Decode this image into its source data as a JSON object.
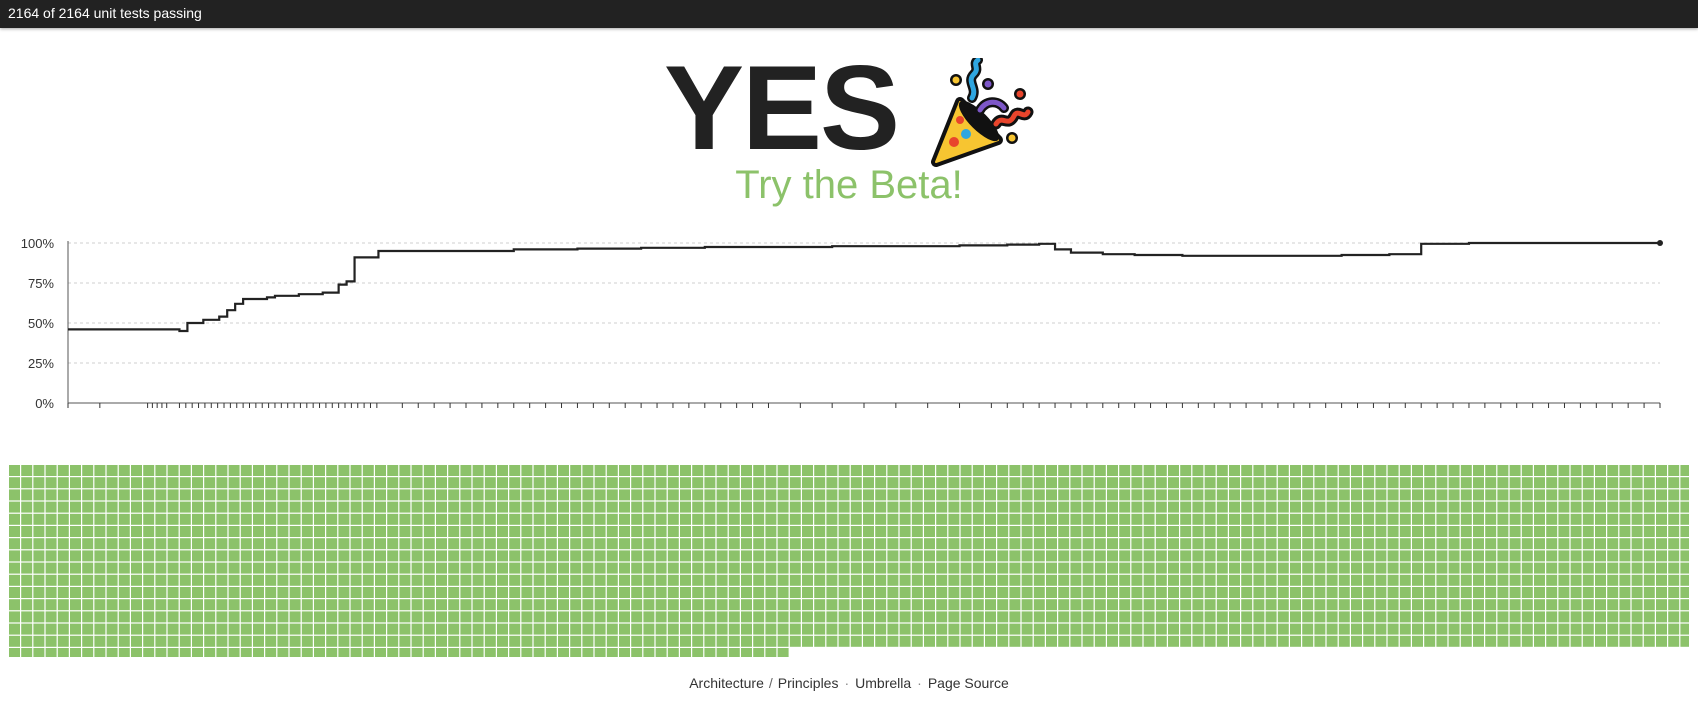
{
  "header": {
    "status_text": "2164 of 2164 unit tests passing"
  },
  "hero": {
    "headline": "YES",
    "icon": "party-popper-icon",
    "beta_link": "Try the Beta!"
  },
  "colors": {
    "accent_green": "#8cc26a",
    "bar_dark": "#222222",
    "line": "#222222"
  },
  "chart_data": {
    "type": "line",
    "ylim": [
      0,
      100
    ],
    "yticks": [
      "0%",
      "25%",
      "50%",
      "75%",
      "100%"
    ],
    "grid": true,
    "x": [
      0,
      3,
      5,
      7,
      7.5,
      8.5,
      9.5,
      10,
      10.5,
      11,
      12.5,
      13,
      14.5,
      16,
      17,
      17.5,
      18,
      19.5,
      24,
      28,
      32,
      36,
      40,
      44,
      48,
      52,
      56,
      59,
      61,
      62,
      63,
      65,
      67,
      70,
      75,
      80,
      83,
      84.5,
      85,
      88,
      92,
      96,
      100
    ],
    "values": [
      46,
      46,
      46,
      45,
      50,
      52,
      54,
      58,
      62,
      65,
      66,
      67,
      68,
      69,
      74,
      76,
      91,
      95,
      95,
      96,
      96.5,
      97,
      97.5,
      97.5,
      98,
      98,
      98.5,
      99,
      99.5,
      96,
      94,
      93,
      92.5,
      92,
      92,
      92.5,
      93,
      93,
      99.5,
      100,
      100,
      100,
      100
    ],
    "ticks_x": [
      0,
      2,
      5,
      5.3,
      5.6,
      5.9,
      6.2,
      7,
      7.4,
      7.8,
      8.2,
      8.6,
      9,
      9.4,
      9.8,
      10.2,
      10.6,
      11,
      11.4,
      11.8,
      12.2,
      12.6,
      13,
      13.4,
      13.8,
      14.2,
      14.6,
      15,
      15.4,
      15.8,
      16.2,
      16.6,
      17,
      17.4,
      17.8,
      18.2,
      18.6,
      19,
      19.4,
      21,
      22,
      23,
      24,
      25,
      26,
      27,
      28,
      29,
      30,
      31,
      32,
      33,
      34,
      35,
      36,
      37,
      38,
      39,
      40,
      41,
      42,
      43,
      44,
      46,
      48,
      50,
      52,
      54,
      56,
      58,
      59,
      60,
      61,
      62,
      63,
      64,
      65,
      66,
      67,
      68,
      69,
      70,
      71,
      72,
      73,
      74,
      75,
      76,
      77,
      78,
      79,
      80,
      81,
      82,
      83,
      84,
      85,
      86,
      87,
      88,
      89,
      90,
      91,
      92,
      93,
      94,
      95,
      96,
      97,
      98,
      99,
      100
    ]
  },
  "tests_grid": {
    "total": 2164,
    "passing": 2164,
    "color": "#8cc26a"
  },
  "footer": {
    "links": [
      "Architecture",
      "Principles",
      "Umbrella",
      "Page Source"
    ],
    "slash": "/",
    "dot": "·"
  }
}
